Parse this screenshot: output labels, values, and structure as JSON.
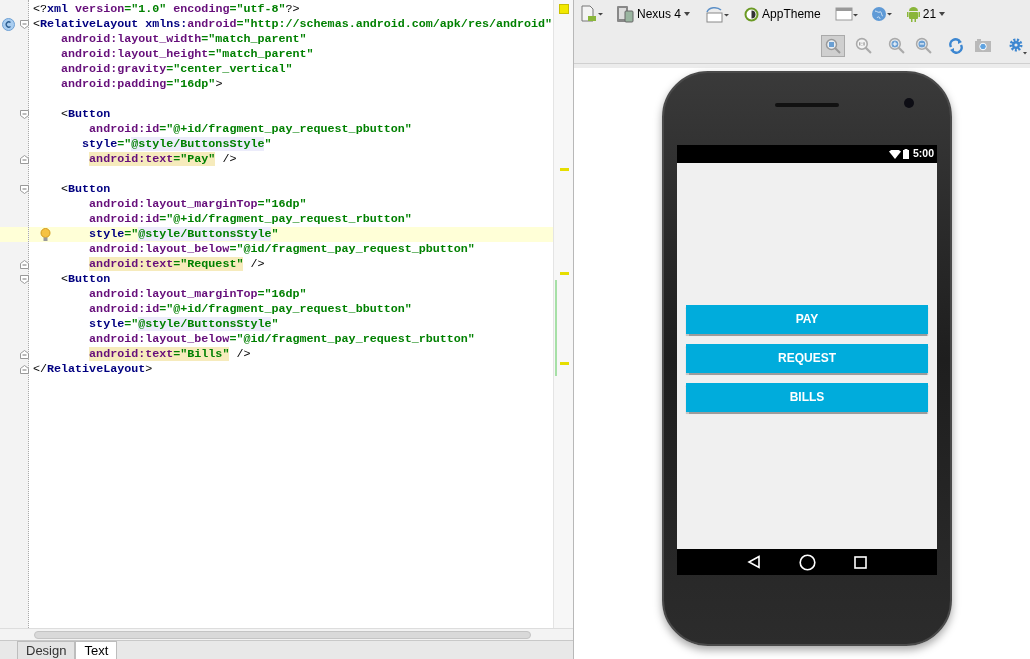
{
  "editor": {
    "lines": [
      {
        "tokens": [
          {
            "kind": "punct",
            "text": "<?"
          },
          {
            "kind": "tag",
            "text": "xml "
          },
          {
            "kind": "ns",
            "text": "version"
          },
          {
            "kind": "value",
            "text": "=\"1.0\" "
          },
          {
            "kind": "ns",
            "text": "encoding"
          },
          {
            "kind": "value",
            "text": "=\"utf-8\""
          },
          {
            "kind": "punct",
            "text": "?>"
          }
        ],
        "kind": "plain",
        "current": false
      },
      {
        "tokens": [
          {
            "kind": "punct",
            "text": "<"
          },
          {
            "kind": "tag",
            "text": "RelativeLayout "
          },
          {
            "kind": "tag",
            "text": "xmlns:"
          },
          {
            "kind": "ns",
            "text": "android"
          },
          {
            "kind": "value",
            "text": "=\"http://schemas.android.com/apk/res/android\""
          }
        ],
        "kind": "root_open",
        "current": false
      },
      {
        "tokens": [
          {
            "kind": "ns",
            "text": "    android:layout_width"
          },
          {
            "kind": "value",
            "text": "=\"match_parent\""
          }
        ],
        "kind": "plain",
        "current": false
      },
      {
        "tokens": [
          {
            "kind": "ns",
            "text": "    android:layout_height"
          },
          {
            "kind": "value",
            "text": "=\"match_parent\""
          }
        ],
        "kind": "plain",
        "current": false
      },
      {
        "tokens": [
          {
            "kind": "ns",
            "text": "    android:gravity"
          },
          {
            "kind": "value",
            "text": "=\"center_vertical\""
          }
        ],
        "kind": "plain",
        "current": false
      },
      {
        "tokens": [
          {
            "kind": "ns",
            "text": "    android:padding"
          },
          {
            "kind": "value",
            "text": "=\"16dp\""
          },
          {
            "kind": "punct",
            "text": ">"
          }
        ],
        "kind": "plain",
        "current": false
      },
      {
        "kind": "blank",
        "current": false
      },
      {
        "tokens": [
          {
            "kind": "punct",
            "text": "    <"
          },
          {
            "kind": "tag",
            "text": "Button"
          }
        ],
        "kind": "fold_open",
        "current": false
      },
      {
        "tokens": [
          {
            "kind": "ns",
            "text": "        android:id"
          },
          {
            "kind": "value",
            "text": "=\"@+id/fragment_pay_request_pbutton\""
          }
        ],
        "kind": "plain",
        "current": false
      },
      {
        "tokens": [
          {
            "kind": "attr",
            "text": "       style"
          },
          {
            "kind": "value",
            "text": "=\""
          },
          {
            "kind": "ref",
            "text": "@style/ButtonsStyle"
          },
          {
            "kind": "value",
            "text": "\""
          }
        ],
        "kind": "plain",
        "current": false
      },
      {
        "tokens": [
          {
            "kind": "hl_ns",
            "text": "        android:text"
          },
          {
            "kind": "hl_value",
            "text": "=\"Pay\""
          },
          {
            "kind": "punct",
            "text": " />"
          }
        ],
        "kind": "fold_close",
        "current": false
      },
      {
        "kind": "blank",
        "current": false
      },
      {
        "tokens": [
          {
            "kind": "punct",
            "text": "    <"
          },
          {
            "kind": "tag",
            "text": "Button"
          }
        ],
        "kind": "fold_open",
        "current": false
      },
      {
        "tokens": [
          {
            "kind": "ns",
            "text": "        android:layout_marginTop"
          },
          {
            "kind": "value",
            "text": "=\"16dp\""
          }
        ],
        "kind": "plain",
        "current": false
      },
      {
        "tokens": [
          {
            "kind": "ns",
            "text": "        android:id"
          },
          {
            "kind": "value",
            "text": "=\"@+id/fragment_pay_request_rbutton\""
          }
        ],
        "kind": "plain",
        "current": false
      },
      {
        "tokens": [
          {
            "kind": "attr",
            "text": "        style"
          },
          {
            "kind": "value",
            "text": "=\""
          },
          {
            "kind": "ref",
            "text": "@style/ButtonsStyle"
          },
          {
            "kind": "value",
            "text": "\""
          }
        ],
        "kind": "plain",
        "current": true
      },
      {
        "tokens": [
          {
            "kind": "ns",
            "text": "        android:layout_below"
          },
          {
            "kind": "value",
            "text": "=\"@id/fragment_pay_request_pbutton\""
          }
        ],
        "kind": "plain",
        "current": false
      },
      {
        "tokens": [
          {
            "kind": "hl_ns",
            "text": "        android:text"
          },
          {
            "kind": "hl_value",
            "text": "=\"Request\""
          },
          {
            "kind": "punct",
            "text": " />"
          }
        ],
        "kind": "fold_close",
        "current": false
      },
      {
        "tokens": [
          {
            "kind": "punct",
            "text": "    <"
          },
          {
            "kind": "tag",
            "text": "Button"
          }
        ],
        "kind": "fold_open",
        "current": false
      },
      {
        "tokens": [
          {
            "kind": "ns",
            "text": "        android:layout_marginTop"
          },
          {
            "kind": "value",
            "text": "=\"16dp\""
          }
        ],
        "kind": "plain",
        "current": false
      },
      {
        "tokens": [
          {
            "kind": "ns",
            "text": "        android:id"
          },
          {
            "kind": "value",
            "text": "=\"@+id/fragment_pay_request_bbutton\""
          }
        ],
        "kind": "plain",
        "current": false
      },
      {
        "tokens": [
          {
            "kind": "attr",
            "text": "        style"
          },
          {
            "kind": "value",
            "text": "=\""
          },
          {
            "kind": "ref",
            "text": "@style/ButtonsStyle"
          },
          {
            "kind": "value",
            "text": "\""
          }
        ],
        "kind": "plain",
        "current": false
      },
      {
        "tokens": [
          {
            "kind": "ns",
            "text": "        android:layout_below"
          },
          {
            "kind": "value",
            "text": "=\"@id/fragment_pay_request_rbutton\""
          }
        ],
        "kind": "plain",
        "current": false
      },
      {
        "tokens": [
          {
            "kind": "hl_ns",
            "text": "        android:text"
          },
          {
            "kind": "hl_value",
            "text": "=\"Bills\""
          },
          {
            "kind": "punct",
            "text": " />"
          }
        ],
        "kind": "fold_close",
        "current": false
      },
      {
        "tokens": [
          {
            "kind": "punct",
            "text": "</"
          },
          {
            "kind": "tag",
            "text": "RelativeLayout"
          },
          {
            "kind": "punct",
            "text": ">"
          }
        ],
        "kind": "fold_close",
        "current": false
      }
    ]
  },
  "editor_tabs": [
    {
      "label": "Design",
      "selected": false
    },
    {
      "label": "Text",
      "selected": true
    }
  ],
  "toolbar": {
    "device": "Nexus 4",
    "theme": "AppTheme",
    "api_level": "21"
  },
  "preview": {
    "status_time": "5:00",
    "buttons": [
      {
        "label": "PAY"
      },
      {
        "label": "REQUEST"
      },
      {
        "label": "BILLS"
      }
    ]
  }
}
